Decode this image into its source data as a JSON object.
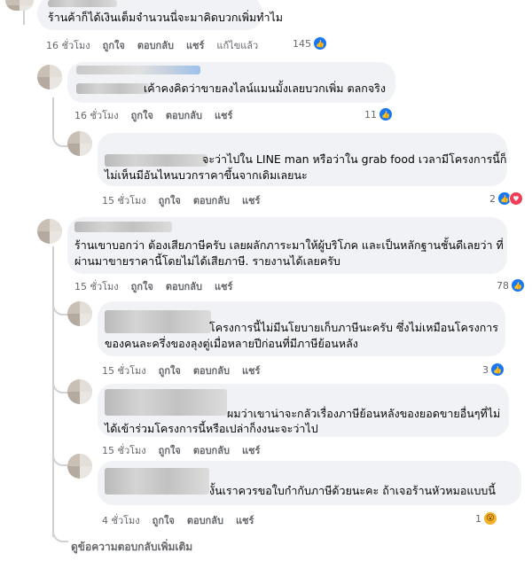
{
  "comments": [
    {
      "text_lines": [
        "ร้านค้าก็ได้เงินเต็มจำนวนนี่จะมาคิดบวกเพิ่มทำไม"
      ],
      "time": "16 ชั่วโมง",
      "like": "ถูกใจ",
      "reply": "ตอบกลับ",
      "share": "แชร์",
      "edited": "แก้ไขแล้ว",
      "reaction_count": "145"
    },
    {
      "text_lines": [
        "เค้าคงคิดว่าขายลงไลน์แมนมั้งเลยบวกเพิ่ม ตลกจริง"
      ],
      "time": "16 ชั่วโมง",
      "like": "ถูกใจ",
      "reply": "ตอบกลับ",
      "share": "แชร์",
      "reaction_count": "11"
    },
    {
      "text_lines": [
        "จะว่าไปใน LINE man หรือว่าใน grab food เวลามีโครงการนี้ก็",
        "ไม่เห็นมีอันไหนบวกราคาขึ้นจากเดิมเลยนะ"
      ],
      "time": "15 ชั่วโมง",
      "like": "ถูกใจ",
      "reply": "ตอบกลับ",
      "share": "แชร์",
      "reaction_count": "2"
    },
    {
      "text_lines": [
        "ร้านเขาบอกว่า ต้องเสียภาษีครับ เลยผลักภาระมาให้ผู้บริโภค และเป็นหลักฐานชั้นดีเลยว่า ที่",
        "ผ่านมาขายราคานี้โดยไม่ได้เสียภาษี. รายงานได้เลยครับ"
      ],
      "time": "15 ชั่วโมง",
      "like": "ถูกใจ",
      "reply": "ตอบกลับ",
      "share": "แชร์",
      "reaction_count": "78"
    },
    {
      "text_lines": [
        "โครงการนี้ไม่มีนโยบายเก็บภาษีนะครับ ซึ่งไม่เหมือนโครงการ",
        "ของคนละครึ่งของลุงตู่เมื่อหลายปีก่อนที่มีภาษีย้อนหลัง"
      ],
      "time": "15 ชั่วโมง",
      "like": "ถูกใจ",
      "reply": "ตอบกลับ",
      "share": "แชร์",
      "reaction_count": "3"
    },
    {
      "text_lines": [
        "ผมว่าเขาน่าจะกลัวเรื่องภาษีย้อนหลังของยอดขายอื่นๆที่ไม่",
        "ได้เข้าร่วมโครงการนี้หรือเปล่าก็งงนะจะว่าไป"
      ],
      "time": "15 ชั่วโมง",
      "like": "ถูกใจ",
      "reply": "ตอบกลับ",
      "share": "แชร์"
    },
    {
      "text_lines": [
        "งั้นเราควรขอใบกำกับภาษีด้วยนะคะ ถ้าเจอร้านหัวหมอแบบนี้"
      ],
      "time": "4 ชั่วโมง",
      "like": "ถูกใจ",
      "reply": "ตอบกลับ",
      "share": "แชร์",
      "reaction_count": "1"
    }
  ],
  "view_more": "ดูข้อความตอบกลับเพิ่มเติม",
  "icons": {
    "like": "like-icon",
    "love": "love-icon",
    "wow": "wow-icon",
    "avatar": "avatar-icon"
  },
  "colors": {
    "bubble": "#f0f2f5",
    "meta": "#65676b",
    "like_blue": "#1877f2",
    "love_red": "#f33e58",
    "wow_yellow": "#f7b125"
  }
}
